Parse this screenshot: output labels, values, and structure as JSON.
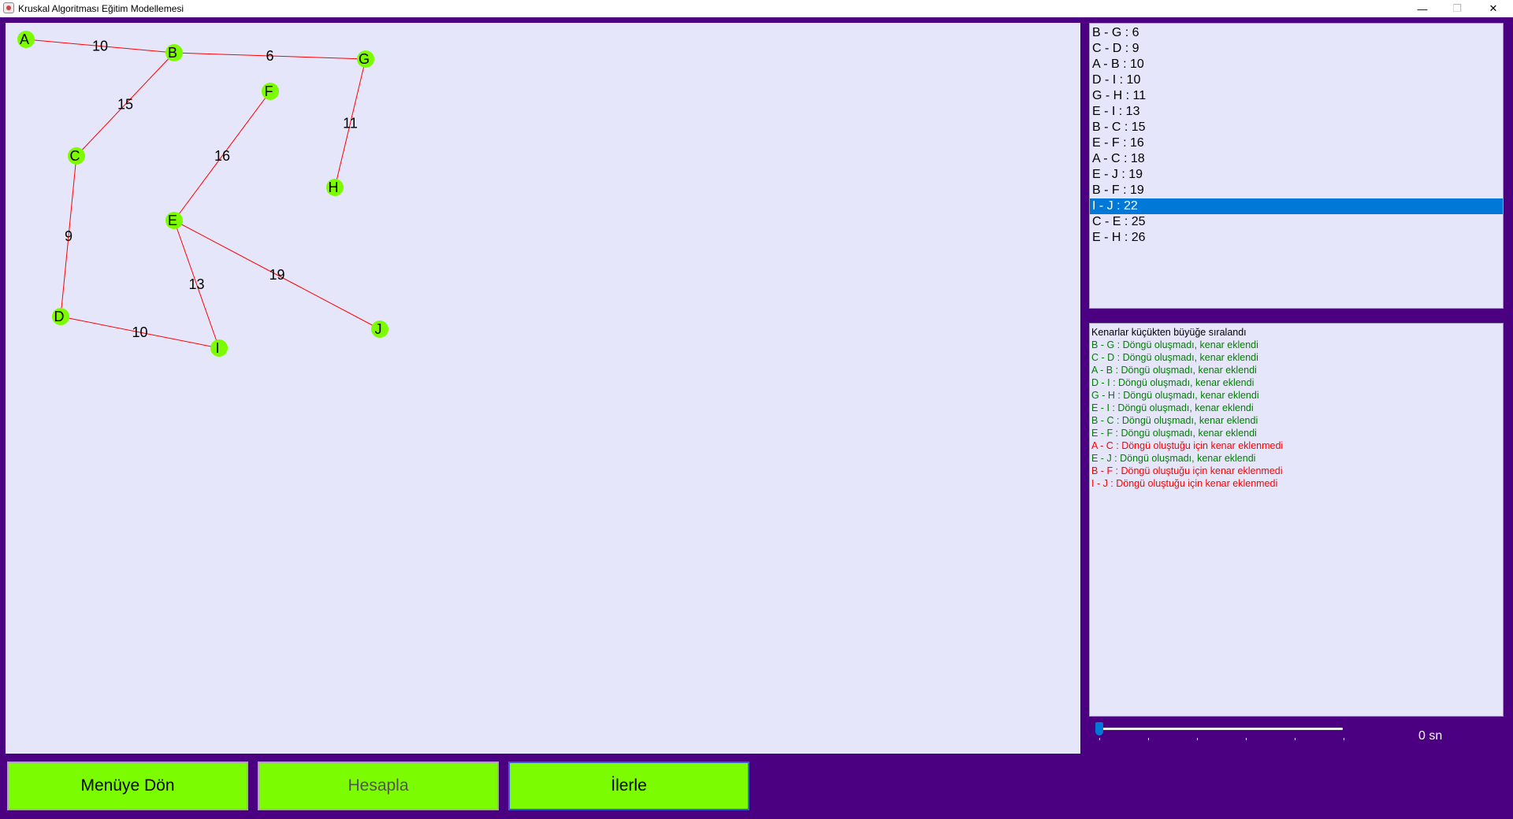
{
  "window": {
    "title": "Kruskal Algoritması Eğitim Modellemesi",
    "minimize": "—",
    "maximize": "❐",
    "close": "✕"
  },
  "colors": {
    "background": "#4b0082",
    "panel": "#e6e6fa",
    "node": "#7cfc00",
    "edge": "#ff0000",
    "button": "#7cfc00",
    "log_added": "#008000",
    "log_rejected": "#ff0000",
    "selection": "#0078d7"
  },
  "graph": {
    "nodes": [
      "A",
      "B",
      "C",
      "D",
      "E",
      "F",
      "G",
      "H",
      "I",
      "J"
    ],
    "edges": [
      {
        "from": "A",
        "to": "B",
        "weight": "10"
      },
      {
        "from": "B",
        "to": "G",
        "weight": "6"
      },
      {
        "from": "B",
        "to": "C",
        "weight": "15"
      },
      {
        "from": "G",
        "to": "H",
        "weight": "11"
      },
      {
        "from": "F",
        "to": "E",
        "weight": "16"
      },
      {
        "from": "C",
        "to": "D",
        "weight": "9"
      },
      {
        "from": "E",
        "to": "I",
        "weight": "13"
      },
      {
        "from": "E",
        "to": "J",
        "weight": "19"
      },
      {
        "from": "D",
        "to": "I",
        "weight": "10"
      }
    ]
  },
  "edge_list": {
    "items": [
      "B - G : 6",
      "C - D : 9",
      "A - B : 10",
      "D - I : 10",
      "G - H : 11",
      "E - I : 13",
      "B - C : 15",
      "E - F : 16",
      "A - C : 18",
      "E - J : 19",
      "B - F : 19",
      "I - J : 22",
      "C - E : 25",
      "E - H : 26"
    ],
    "selected_index": 11
  },
  "log": {
    "lines": [
      {
        "text": "Kenarlar küçükten büyüğe sıralandı",
        "status": "info"
      },
      {
        "text": "B - G : Döngü oluşmadı, kenar eklendi",
        "status": "added"
      },
      {
        "text": "C - D : Döngü oluşmadı, kenar eklendi",
        "status": "added"
      },
      {
        "text": "A - B : Döngü oluşmadı, kenar eklendi",
        "status": "added"
      },
      {
        "text": "D - I : Döngü oluşmadı, kenar eklendi",
        "status": "added"
      },
      {
        "text": "G - H : Döngü oluşmadı, kenar eklendi",
        "status": "added"
      },
      {
        "text": "E - I : Döngü oluşmadı, kenar eklendi",
        "status": "added"
      },
      {
        "text": "B - C : Döngü oluşmadı, kenar eklendi",
        "status": "added"
      },
      {
        "text": "E - F : Döngü oluşmadı, kenar eklendi",
        "status": "added"
      },
      {
        "text": "A - C : Döngü oluştuğu için kenar eklenmedi",
        "status": "rejected"
      },
      {
        "text": "E - J : Döngü oluşmadı, kenar eklendi",
        "status": "added"
      },
      {
        "text": "B - F : Döngü oluştuğu için kenar eklenmedi",
        "status": "rejected"
      },
      {
        "text": "I - J : Döngü oluştuğu için kenar eklenmedi",
        "status": "rejected"
      }
    ]
  },
  "speed": {
    "value": 0,
    "label": "0 sn",
    "tick_count": 6
  },
  "buttons": {
    "menu": "Menüye Dön",
    "calculate": "Hesapla",
    "next": "İlerle"
  }
}
